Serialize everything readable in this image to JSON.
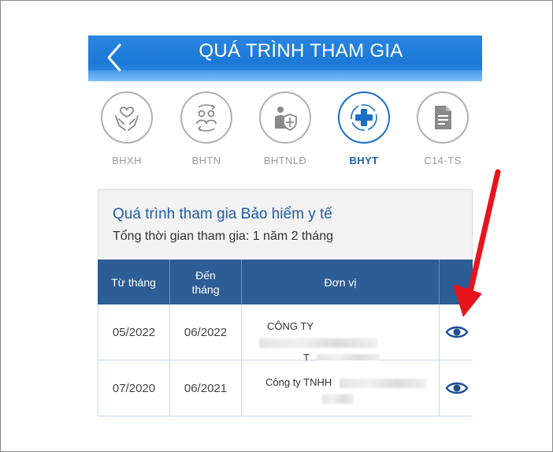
{
  "header": {
    "title": "QUÁ TRÌNH THAM GIA"
  },
  "categories": [
    {
      "label": "BHXH",
      "icon": "hands-heart-icon",
      "active": false
    },
    {
      "label": "BHTN",
      "icon": "people-cycle-icon",
      "active": false
    },
    {
      "label": "BHTNLĐ",
      "icon": "worker-shield-icon",
      "active": false
    },
    {
      "label": "BHYT",
      "icon": "medical-cross-icon",
      "active": true
    },
    {
      "label": "C14-TS",
      "icon": "document-icon",
      "active": false
    }
  ],
  "panel": {
    "title": "Quá trình tham gia Bảo hiểm y tế",
    "subtitle": "Tổng thời gian tham gia: 1 năm 2 tháng"
  },
  "table": {
    "headers": {
      "from": "Từ tháng",
      "to_line1": "Đến",
      "to_line2": "tháng",
      "unit": "Đơn vị"
    },
    "rows": [
      {
        "from": "05/2022",
        "to": "06/2022",
        "unit_prefix": "CÔNG TY",
        "unit_line2": "T",
        "action_icon": "eye-icon"
      },
      {
        "from": "07/2020",
        "to": "06/2021",
        "unit_prefix": "Công ty TNHH",
        "unit_line2": "",
        "action_icon": "eye-icon"
      }
    ]
  },
  "colors": {
    "header_blue": "#1c78d6",
    "table_header": "#2c5d94",
    "active_blue": "#1a70c8",
    "annotation_red": "#e8141c"
  }
}
